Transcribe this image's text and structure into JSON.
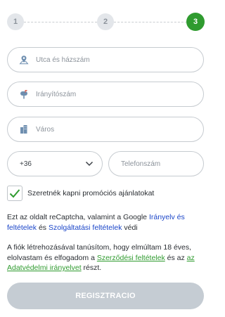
{
  "stepper": {
    "steps": [
      {
        "label": "1",
        "state": "inactive"
      },
      {
        "label": "2",
        "state": "inactive"
      },
      {
        "label": "3",
        "state": "active"
      }
    ],
    "active_color": "#2f9b2f",
    "inactive_color": "#e3e6ea"
  },
  "form": {
    "street_placeholder": "Utca és házszám",
    "postal_placeholder": "Irányítószám",
    "city_placeholder": "Város",
    "country_code_value": "+36",
    "phone_placeholder": "Telefonszám"
  },
  "promo": {
    "checked": true,
    "label": "Szeretnék kapni promóciós ajánlatokat"
  },
  "recaptcha": {
    "text_before": "Ezt az oldalt reCaptcha, valamint a Google ",
    "privacy_link": "Irányelv és feltételek",
    "text_middle": " és ",
    "terms_link": "Szolgáltatási feltételek",
    "text_after": " védi"
  },
  "consent": {
    "text_before": "A fiók létrehozásával tanúsítom, hogy elmúltam 18 éves, elolvastam és elfogadom a ",
    "contract_link": "Szerződési feltételek",
    "text_middle": " és az ",
    "privacy_link": "az Adatvédelmi irányelvet",
    "text_after": " részt."
  },
  "register_button": {
    "label": "REGISZTRACIO",
    "color": "#c5ccd3"
  },
  "icons": {
    "street": "map-pin-icon",
    "postal": "mailbox-icon",
    "city": "building-icon",
    "dropdown": "chevron-down-icon",
    "check": "checkmark-icon"
  }
}
